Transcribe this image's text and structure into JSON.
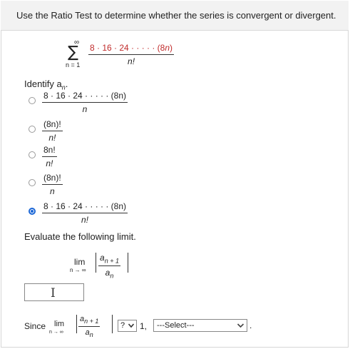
{
  "question": {
    "instruction": "Use the Ratio Test to determine whether the series is convergent or divergent."
  },
  "series": {
    "sigma": "∑",
    "upper": "∞",
    "lower": "n = 1",
    "numerator_prefix": "8 · 16 · 24 · · · · · (8",
    "numerator_var": "n",
    "numerator_suffix": ")",
    "denominator": "n!"
  },
  "identify": {
    "label": "Identify a",
    "label_sub": "n",
    "label_end": ".",
    "options": [
      {
        "num": "8 · 16 · 24 · · · · · (8n)",
        "den": "n",
        "selected": false
      },
      {
        "num": "(8n)!",
        "den": "n!",
        "selected": false
      },
      {
        "num": "8n!",
        "den": "n!",
        "selected": false
      },
      {
        "num": "(8n)!",
        "den": "n",
        "selected": false
      },
      {
        "num": "8 · 16 · 24 · · · · · (8n)",
        "den": "n!",
        "selected": true
      }
    ]
  },
  "limit": {
    "prompt": "Evaluate the following limit.",
    "lim": "lim",
    "approach": "n → ∞",
    "num": "a",
    "num_sub": "n + 1",
    "den": "a",
    "den_sub": "n"
  },
  "answer": {
    "value": "",
    "cursor": "I"
  },
  "conclusion": {
    "since": "Since",
    "lim": "lim",
    "approach": "n → ∞",
    "num": "a",
    "num_sub": "n + 1",
    "den": "a",
    "den_sub": "n",
    "compare_value": "?",
    "one": "1,",
    "select_value": "---Select---",
    "end": "."
  },
  "colors": {
    "selected_radio": "#1a66d6",
    "series_numerator": "#c02b2b"
  }
}
